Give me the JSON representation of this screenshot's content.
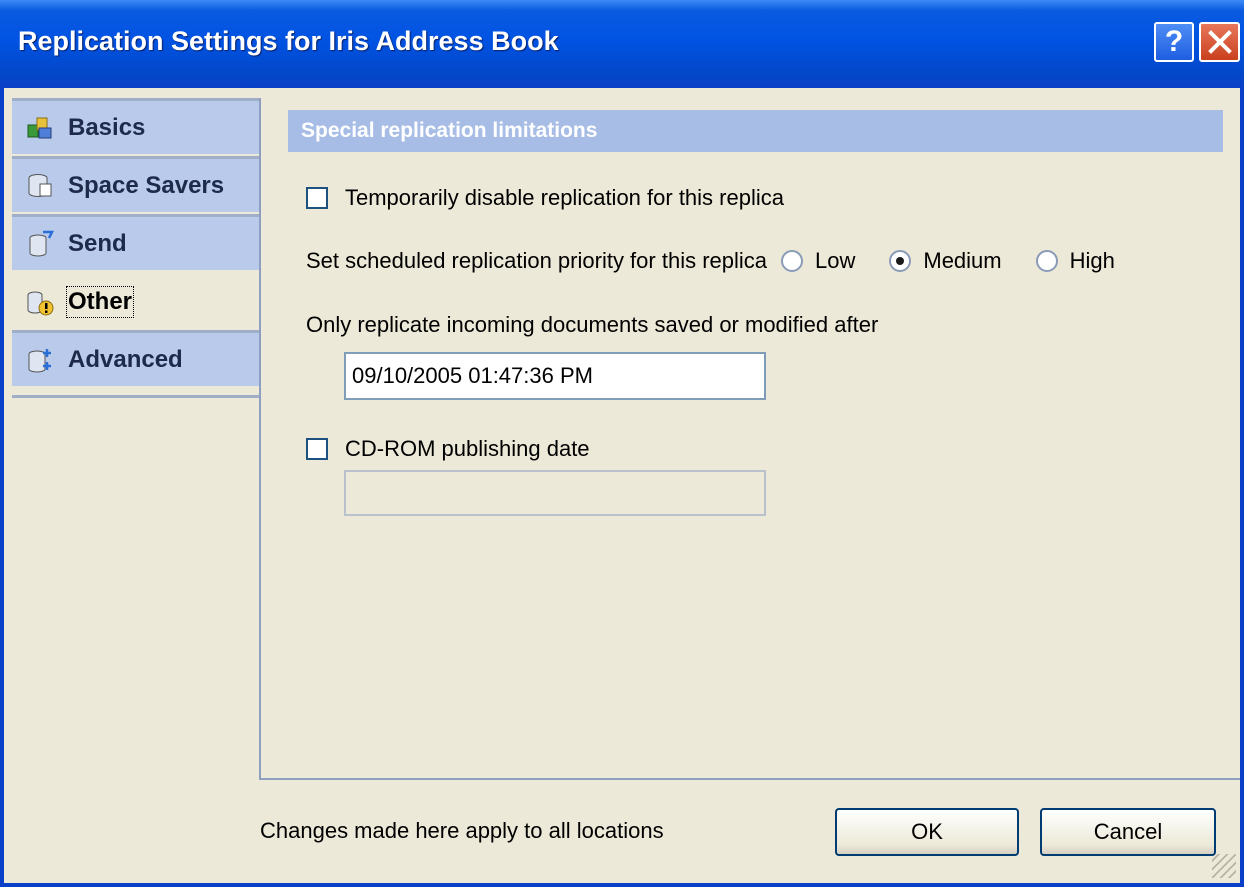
{
  "window": {
    "title": "Replication Settings for Iris Address Book",
    "help_label": "?",
    "close_label": "✕"
  },
  "nav": {
    "items": [
      {
        "label": "Basics",
        "icon": "basics-icon",
        "active": false
      },
      {
        "label": "Space Savers",
        "icon": "space-savers-icon",
        "active": false
      },
      {
        "label": "Send",
        "icon": "send-icon",
        "active": false
      },
      {
        "label": "Other",
        "icon": "other-icon",
        "active": true
      },
      {
        "label": "Advanced",
        "icon": "advanced-icon",
        "active": false
      }
    ]
  },
  "section": {
    "header": "Special replication limitations",
    "disable_replication": {
      "label": "Temporarily disable replication for this replica",
      "checked": false
    },
    "priority": {
      "label": "Set scheduled replication priority for this replica",
      "options": [
        {
          "label": "Low",
          "selected": false
        },
        {
          "label": "Medium",
          "selected": true
        },
        {
          "label": "High",
          "selected": false
        }
      ]
    },
    "incoming": {
      "label": "Only replicate incoming documents saved or modified after",
      "value": "09/10/2005 01:47:36 PM"
    },
    "cdrom": {
      "label": "CD-ROM publishing date",
      "checked": false,
      "value": ""
    }
  },
  "footer": {
    "note": "Changes made here apply to all locations",
    "ok_label": "OK",
    "cancel_label": "Cancel"
  },
  "colors": {
    "titlebar": "#0153e3",
    "nav_item": "#b9caeb",
    "section_header": "#a8bde6",
    "dialog_bg": "#ece9d8"
  }
}
